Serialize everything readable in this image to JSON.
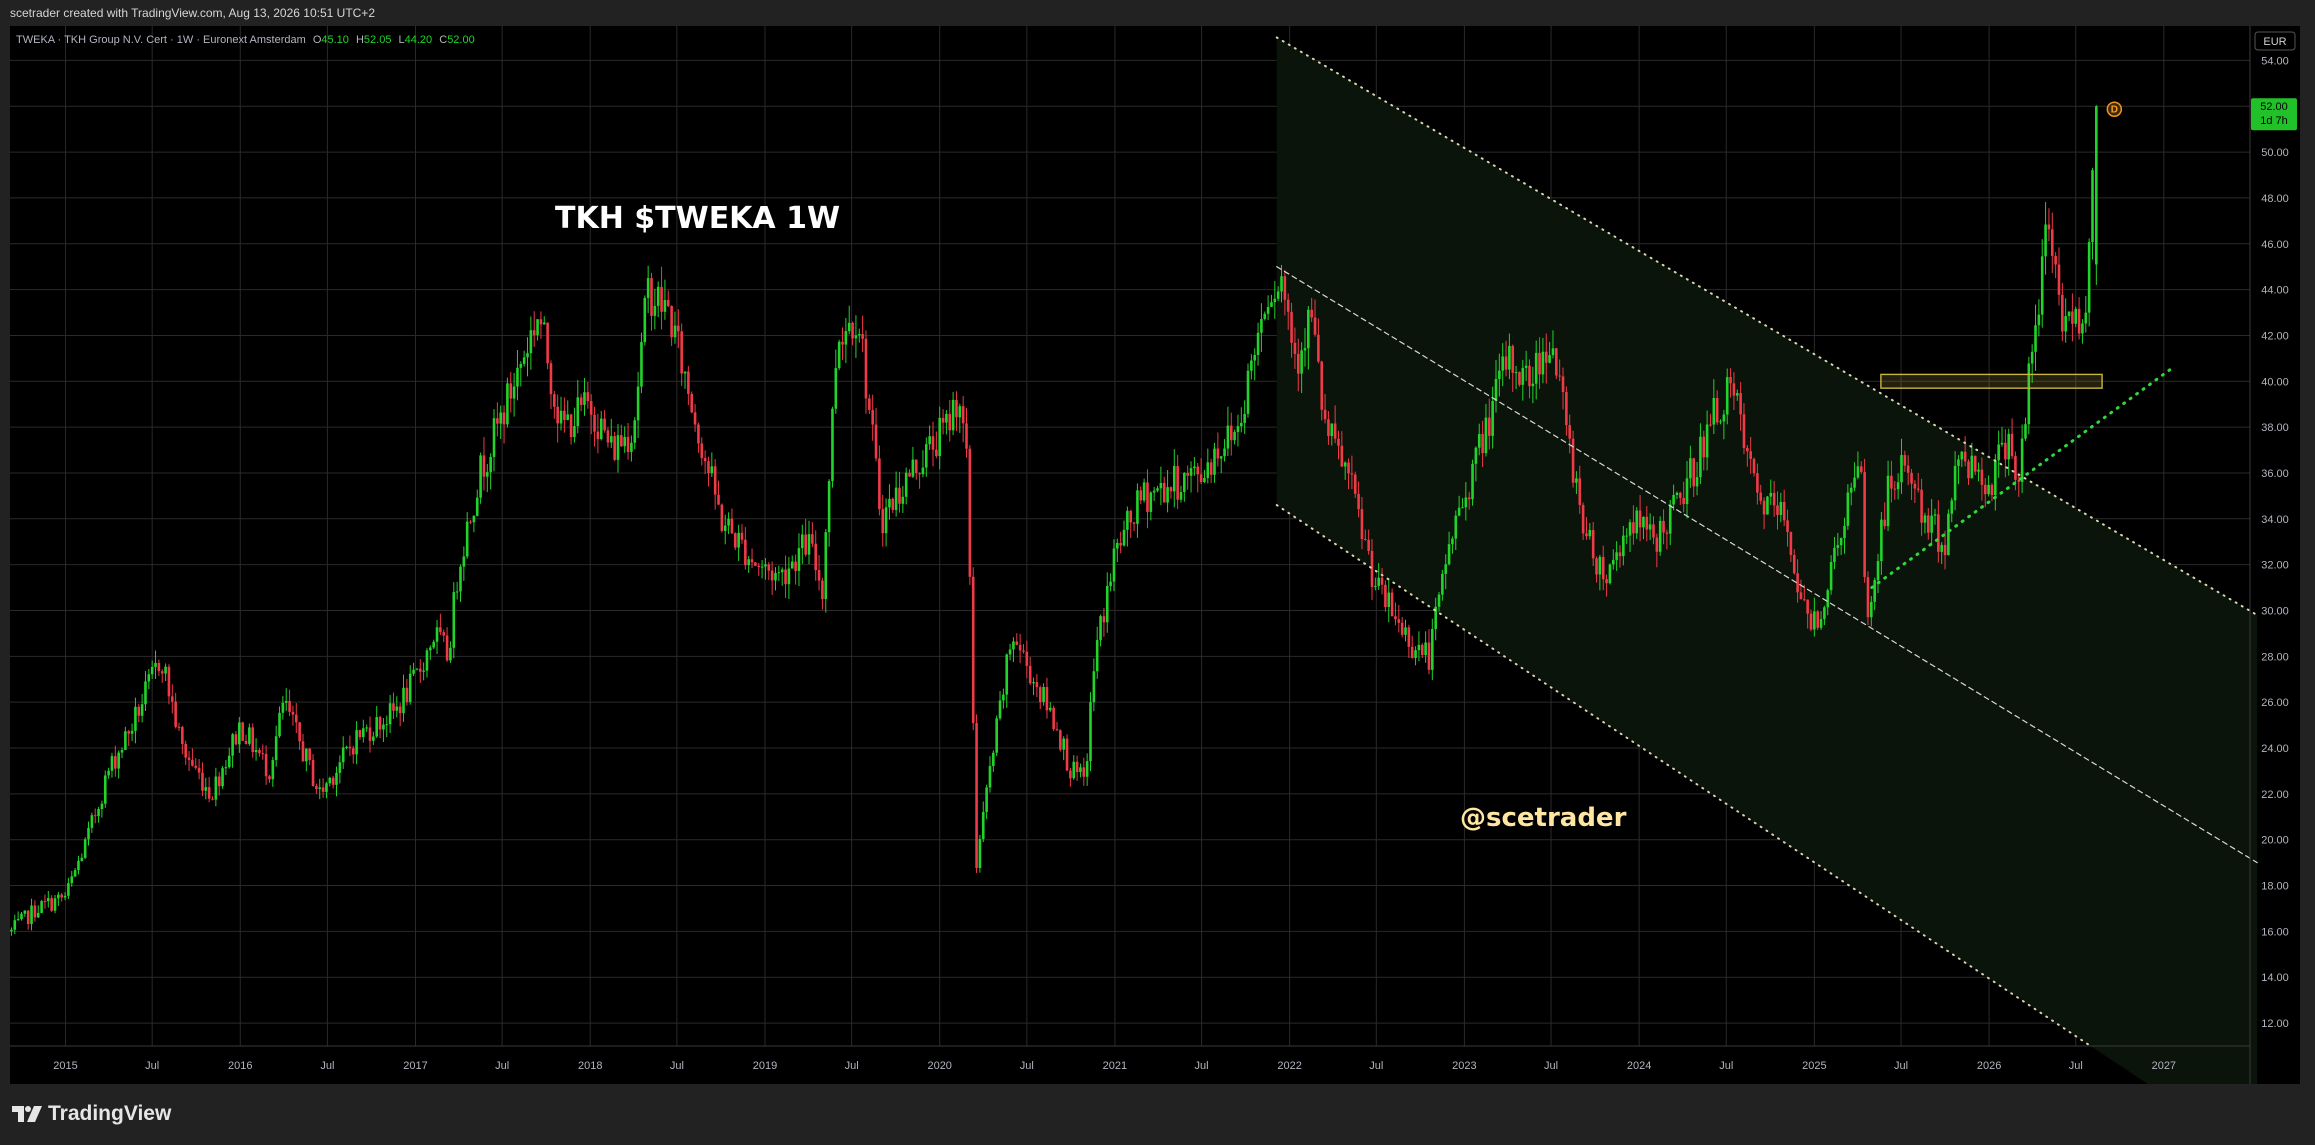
{
  "header": {
    "text": "scetrader created with TradingView.com, Aug 13, 2026 10:51 UTC+2"
  },
  "legend": {
    "symbol": "TWEKA · TKH Group N.V. Cert · 1W · Euronext Amsterdam",
    "open_label": "O",
    "open": "45.10",
    "high_label": "H",
    "high": "52.05",
    "low_label": "L",
    "low": "44.20",
    "close_label": "C",
    "close": "52.00"
  },
  "currency": "EUR",
  "price_tag": {
    "value": "52.00",
    "countdown": "1d 7h"
  },
  "dividend_marker": "D",
  "annotations": {
    "title": "TKH $TWEKA 1W",
    "watermark": "@scetrader"
  },
  "footer": {
    "brand": "TradingView"
  },
  "colors": {
    "up": "#22d32b",
    "down": "#ef3a47",
    "background": "#000000",
    "grid": "#2a2a2a",
    "channel_fill": "#0a140a",
    "annotation_yellow": "#ffe7a3",
    "zone": "#c8b440"
  },
  "chart_data": {
    "type": "candlestick",
    "timeframe": "1W",
    "y_axis": {
      "ticks": [
        "12.00",
        "14.00",
        "16.00",
        "18.00",
        "20.00",
        "22.00",
        "24.00",
        "26.00",
        "28.00",
        "30.00",
        "32.00",
        "34.00",
        "36.00",
        "38.00",
        "40.00",
        "42.00",
        "44.00",
        "46.00",
        "48.00",
        "50.00",
        "52.00",
        "54.00"
      ],
      "ylim": [
        11,
        55.5
      ],
      "position": "right"
    },
    "x_axis": {
      "xlim": [
        "2014-09-07",
        "2027-06-30"
      ],
      "ticks": [
        {
          "label": "2015",
          "date": "2015-01-01"
        },
        {
          "label": "Jul",
          "date": "2015-07-01"
        },
        {
          "label": "2016",
          "date": "2016-01-01"
        },
        {
          "label": "Jul",
          "date": "2016-07-01"
        },
        {
          "label": "2017",
          "date": "2017-01-01"
        },
        {
          "label": "Jul",
          "date": "2017-07-01"
        },
        {
          "label": "2018",
          "date": "2018-01-01"
        },
        {
          "label": "Jul",
          "date": "2018-07-01"
        },
        {
          "label": "2019",
          "date": "2019-01-01"
        },
        {
          "label": "Jul",
          "date": "2019-07-01"
        },
        {
          "label": "2020",
          "date": "2020-01-01"
        },
        {
          "label": "Jul",
          "date": "2020-07-01"
        },
        {
          "label": "2021",
          "date": "2021-01-01"
        },
        {
          "label": "Jul",
          "date": "2021-07-01"
        },
        {
          "label": "2022",
          "date": "2022-01-01"
        },
        {
          "label": "Jul",
          "date": "2022-07-01"
        },
        {
          "label": "2023",
          "date": "2023-01-01"
        },
        {
          "label": "Jul",
          "date": "2023-07-01"
        },
        {
          "label": "2024",
          "date": "2024-01-01"
        },
        {
          "label": "Jul",
          "date": "2024-07-01"
        },
        {
          "label": "2025",
          "date": "2025-01-01"
        },
        {
          "label": "Jul",
          "date": "2025-07-01"
        },
        {
          "label": "2026",
          "date": "2026-01-01"
        },
        {
          "label": "Jul",
          "date": "2026-07-01"
        },
        {
          "label": "2027",
          "date": "2027-01-01"
        }
      ]
    },
    "grid": true,
    "price_path": [
      [
        "2014-09-10",
        16.0
      ],
      [
        "2014-11-01",
        17.0
      ],
      [
        "2015-01-01",
        17.5
      ],
      [
        "2015-02-15",
        20.0
      ],
      [
        "2015-04-01",
        23.0
      ],
      [
        "2015-05-20",
        25.0
      ],
      [
        "2015-07-20",
        28.0
      ],
      [
        "2015-09-01",
        24.0
      ],
      [
        "2015-11-01",
        22.0
      ],
      [
        "2016-01-01",
        25.0
      ],
      [
        "2016-03-01",
        23.0
      ],
      [
        "2016-04-01",
        26.0
      ],
      [
        "2016-06-15",
        22.0
      ],
      [
        "2016-09-01",
        24.5
      ],
      [
        "2016-11-15",
        25.5
      ],
      [
        "2017-01-01",
        27.0
      ],
      [
        "2017-02-10",
        29.0
      ],
      [
        "2017-03-10",
        28.0
      ],
      [
        "2017-04-01",
        32.0
      ],
      [
        "2017-05-15",
        36.0
      ],
      [
        "2017-07-01",
        38.5
      ],
      [
        "2017-09-15",
        43.0
      ],
      [
        "2017-11-01",
        38.0
      ],
      [
        "2018-01-01",
        39.0
      ],
      [
        "2018-02-15",
        37.0
      ],
      [
        "2018-04-01",
        38.0
      ],
      [
        "2018-05-01",
        44.0
      ],
      [
        "2018-06-15",
        43.0
      ],
      [
        "2018-08-01",
        39.0
      ],
      [
        "2018-10-01",
        34.0
      ],
      [
        "2018-12-15",
        32.0
      ],
      [
        "2019-02-01",
        31.5
      ],
      [
        "2019-04-01",
        33.0
      ],
      [
        "2019-05-01",
        31.0
      ],
      [
        "2019-06-01",
        42.0
      ],
      [
        "2019-07-15",
        43.0
      ],
      [
        "2019-09-01",
        34.0
      ],
      [
        "2019-11-01",
        36.0
      ],
      [
        "2020-01-15",
        38.0
      ],
      [
        "2020-02-10",
        39.5
      ],
      [
        "2020-02-28",
        36.0
      ],
      [
        "2020-03-18",
        19.0
      ],
      [
        "2020-04-15",
        23.0
      ],
      [
        "2020-06-01",
        29.0
      ],
      [
        "2020-07-15",
        27.0
      ],
      [
        "2020-09-01",
        25.0
      ],
      [
        "2020-10-01",
        23.0
      ],
      [
        "2020-10-30",
        22.5
      ],
      [
        "2020-11-20",
        28.0
      ],
      [
        "2021-01-01",
        32.5
      ],
      [
        "2021-03-01",
        35.0
      ],
      [
        "2021-05-01",
        35.5
      ],
      [
        "2021-07-01",
        36.0
      ],
      [
        "2021-08-01",
        37.0
      ],
      [
        "2021-09-15",
        38.0
      ],
      [
        "2021-11-15",
        44.0
      ],
      [
        "2021-12-15",
        44.5
      ],
      [
        "2022-01-15",
        41.0
      ],
      [
        "2022-02-15",
        43.0
      ],
      [
        "2022-03-15",
        38.0
      ],
      [
        "2022-05-01",
        36.0
      ],
      [
        "2022-07-01",
        31.0
      ],
      [
        "2022-09-15",
        28.5
      ],
      [
        "2022-10-20",
        28.0
      ],
      [
        "2022-12-01",
        33.0
      ],
      [
        "2023-02-01",
        37.0
      ],
      [
        "2023-04-01",
        41.0
      ],
      [
        "2023-05-15",
        40.0
      ],
      [
        "2023-07-01",
        42.0
      ],
      [
        "2023-08-01",
        38.0
      ],
      [
        "2023-09-15",
        33.0
      ],
      [
        "2023-10-25",
        31.5
      ],
      [
        "2023-12-15",
        34.0
      ],
      [
        "2024-02-01",
        33.0
      ],
      [
        "2024-04-01",
        35.0
      ],
      [
        "2024-06-15",
        39.0
      ],
      [
        "2024-07-15",
        39.5
      ],
      [
        "2024-09-01",
        35.0
      ],
      [
        "2024-11-01",
        34.0
      ],
      [
        "2024-12-15",
        29.5
      ],
      [
        "2025-01-15",
        30.0
      ],
      [
        "2025-03-15",
        35.0
      ],
      [
        "2025-04-10",
        36.0
      ],
      [
        "2025-04-20",
        29.0
      ],
      [
        "2025-06-01",
        35.0
      ],
      [
        "2025-07-15",
        36.5
      ],
      [
        "2025-08-15",
        34.0
      ],
      [
        "2025-10-01",
        33.0
      ],
      [
        "2025-11-01",
        37.0
      ],
      [
        "2026-01-01",
        35.5
      ],
      [
        "2026-02-15",
        38.0
      ],
      [
        "2026-03-01",
        35.0
      ],
      [
        "2026-03-25",
        40.0
      ],
      [
        "2026-04-15",
        43.0
      ],
      [
        "2026-05-01",
        47.5
      ],
      [
        "2026-06-01",
        43.0
      ],
      [
        "2026-07-01",
        42.5
      ],
      [
        "2026-07-25",
        44.0
      ],
      [
        "2026-08-13",
        52.0
      ]
    ],
    "last_bar": {
      "date": "2026-08-13",
      "open": 45.1,
      "high": 52.05,
      "low": 44.2,
      "close": 52.0
    },
    "drawings": {
      "channel_upper": {
        "style": "dotted",
        "from": [
          "2021-12-05",
          55.0
        ],
        "to": [
          "2027-07-15",
          29.8
        ]
      },
      "channel_mid": {
        "style": "dashed",
        "from": [
          "2021-12-05",
          45.0
        ],
        "to": [
          "2027-07-15",
          19.0
        ]
      },
      "channel_lower": {
        "style": "dotted",
        "from": [
          "2021-12-05",
          34.6
        ],
        "to": [
          "2026-08-01",
          11.0
        ]
      },
      "support_trendline": {
        "style": "dotted",
        "from": [
          "2025-05-01",
          31.0
        ],
        "to": [
          "2027-01-20",
          40.6
        ]
      },
      "breakout_zone": {
        "from": "2025-05-20",
        "to": "2026-08-25",
        "y_top": 40.3,
        "y_bottom": 39.7
      }
    }
  }
}
